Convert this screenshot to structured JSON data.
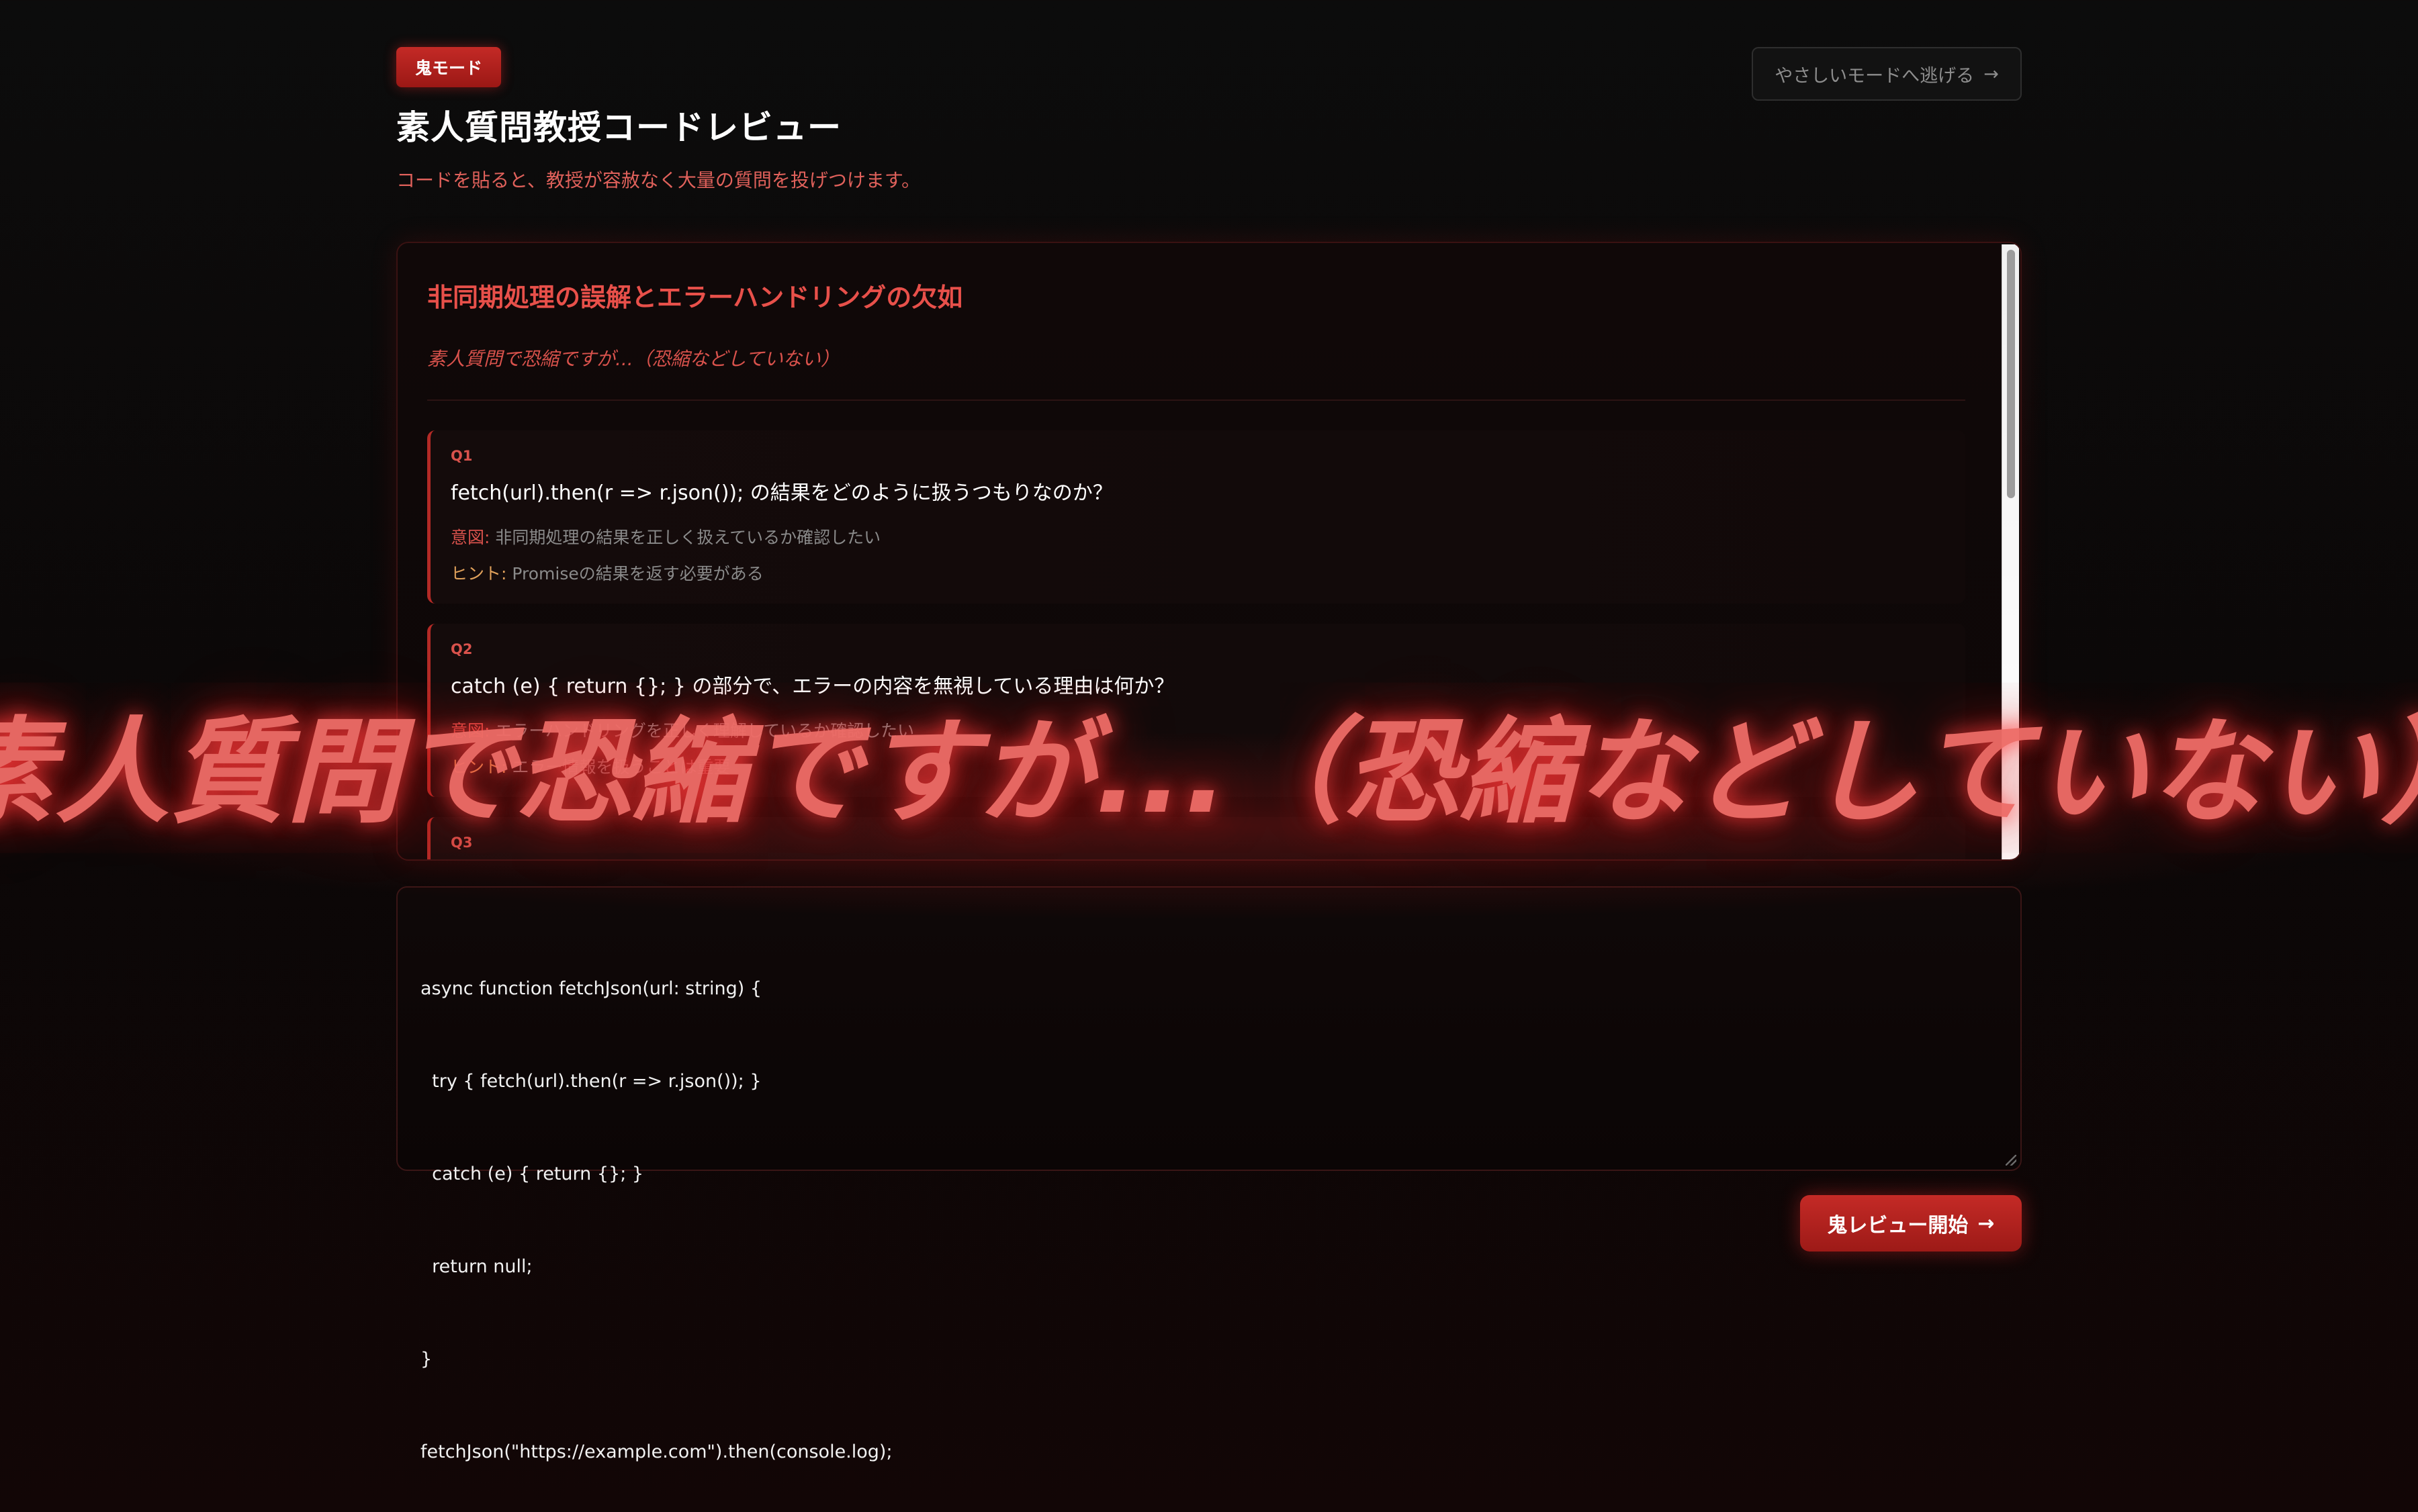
{
  "header": {
    "mode_badge": "鬼モード",
    "title": "素人質問教授コードレビュー",
    "subtitle": "コードを貼ると、教授が容赦なく大量の質問を投げつけます。",
    "escape_button_label": "やさしいモードへ逃げる",
    "escape_button_icon": "→"
  },
  "review": {
    "heading": "非同期処理の誤解とエラーハンドリングの欠如",
    "tagline": "素人質問で恐縮ですが...（恐縮などしていない）",
    "intent_label": "意図:",
    "hint_label": "ヒント:",
    "questions": [
      {
        "num": "Q1",
        "text": "fetch(url).then(r => r.json()); の結果をどのように扱うつもりなのか？",
        "intent": "非同期処理の結果を正しく扱えているか確認したい",
        "hint": "Promiseの結果を返す必要がある"
      },
      {
        "num": "Q2",
        "text": "catch (e) { return {}; } の部分で、エラーの内容を無視している理由は何か？",
        "intent": "エラーハンドリングを正しく理解しているか確認したい",
        "hint": "エラー情報を扱うことは重要"
      },
      {
        "num": "Q3",
        "text": "",
        "intent": "",
        "hint": ""
      }
    ]
  },
  "code_editor": {
    "lines": [
      "async function fetchJson(url: string) {",
      "  try { fetch(url).then(r => r.json()); }",
      "  catch (e) { return {}; }",
      "  return null;",
      "}",
      "fetchJson(\"https://example.com\").then(console.log);"
    ]
  },
  "start_button": {
    "label": "鬼レビュー開始",
    "icon": "→"
  },
  "overlay": {
    "text": "素人質問で恐縮ですが...（恐縮などしていない）"
  },
  "colors": {
    "accent_red": "#c42a26",
    "heading_red": "#e8504a",
    "hint_orange": "#e0a15b",
    "background": "#0c0c0c"
  }
}
